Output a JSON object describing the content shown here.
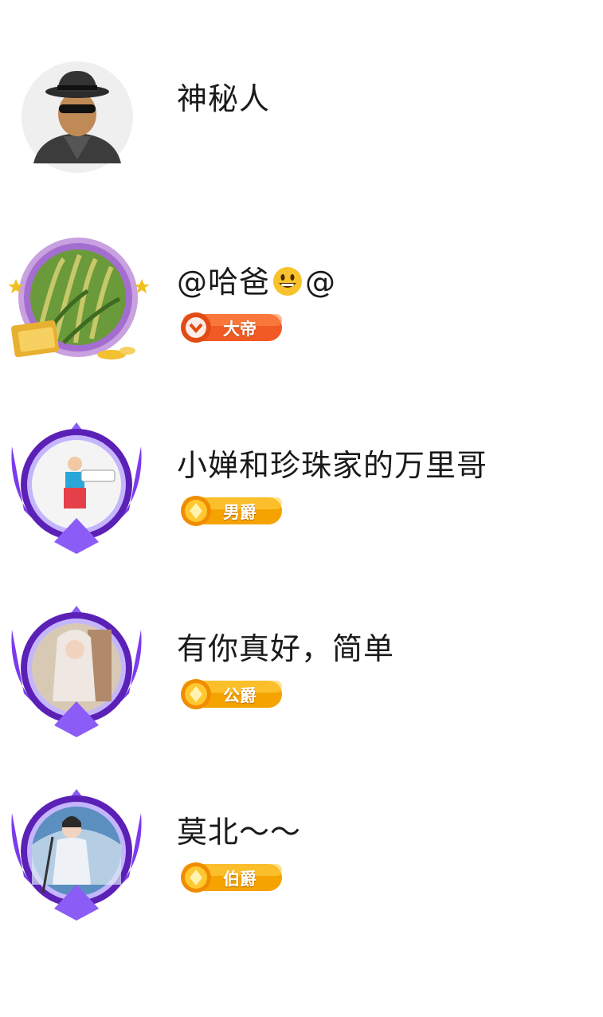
{
  "rows": [
    {
      "name": "神秘人",
      "avatar": "mystery-man-avatar",
      "badge": null
    },
    {
      "name_prefix": "@哈爸",
      "name_suffix": "@",
      "emoji": "grinning-face",
      "avatar": "rice-field-avatar",
      "badge": {
        "label": "大帝",
        "color": "#f15a24",
        "icon": "chevron-down-icon"
      }
    },
    {
      "name": "小婵和珍珠家的万里哥",
      "avatar": "girl-photo-avatar",
      "badge": {
        "label": "男爵",
        "color": "#f5a300",
        "icon": "diamond-icon"
      }
    },
    {
      "name": "有你真好，简单",
      "avatar": "girl-portrait-avatar",
      "badge": {
        "label": "公爵",
        "color": "#f5a300",
        "icon": "diamond-icon"
      }
    },
    {
      "name": "莫北～～",
      "avatar": "swordsman-avatar",
      "badge": {
        "label": "伯爵",
        "color": "#f5a300",
        "icon": "diamond-icon"
      }
    }
  ]
}
